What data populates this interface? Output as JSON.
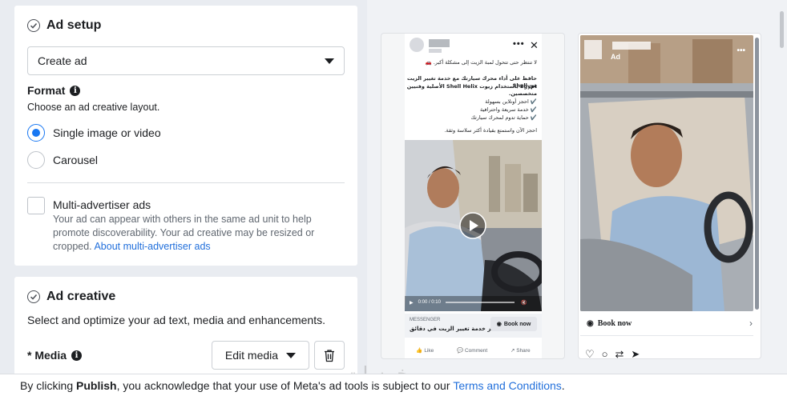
{
  "ad_setup": {
    "title": "Ad setup",
    "select_value": "Create ad",
    "format_label": "Format",
    "format_sub": "Choose an ad creative layout.",
    "options": [
      {
        "label": "Single image or video",
        "selected": true
      },
      {
        "label": "Carousel",
        "selected": false
      }
    ],
    "multi_advertiser": {
      "title": "Multi-advertiser ads",
      "desc": "Your ad can appear with others in the same ad unit to help promote discoverability. Your ad creative may be resized or cropped.",
      "link": "About multi-advertiser ads",
      "checked": false
    }
  },
  "ad_creative": {
    "title": "Ad creative",
    "subtitle": "Select and optimize your ad text, media and enhancements.",
    "media_label": "* Media",
    "edit_media": "Edit media"
  },
  "feed_preview": {
    "line1": "لا تنتظر حتى تتحول لمبة الزيت إلى مشكلة أكبر. 🚗",
    "line2a": "حافظ على أداء محرك سيارتك مع خدمة تغيير الزيت من Shell",
    "line2b": "Egypt باستخدام زيوت Shell Helix الأصلية وفنيين متخصصين.",
    "checks": [
      "✔️ احجز أونلاين بسهولة",
      "✔️ خدمة سريعة واحترافية",
      "✔️ حماية تدوم لمحرك سيارتك"
    ],
    "line3": "احجز الآن واستمتع بقيادة أكثر سلاسة وثقة.",
    "time": "0:00 / 0:10",
    "cta_small": "MESSENGER",
    "cta_title": "احجز خدمة تغيير الزيت في دقائق",
    "cta_button": "Book now",
    "actions": [
      "Like",
      "Comment",
      "Share"
    ]
  },
  "story_preview": {
    "ad_label": "Ad",
    "cta_button": "Book now"
  },
  "footer": {
    "prefix": "By clicking ",
    "bold": "Publish",
    "middle": ", you acknowledge that your use of Meta's ad tools is subject to our ",
    "link": "Terms and Conditions",
    "suffix": "."
  },
  "watermark": "خمسات",
  "colors": {
    "accent": "#1877f2",
    "link": "#216fdb",
    "background": "#e9ecf1"
  }
}
